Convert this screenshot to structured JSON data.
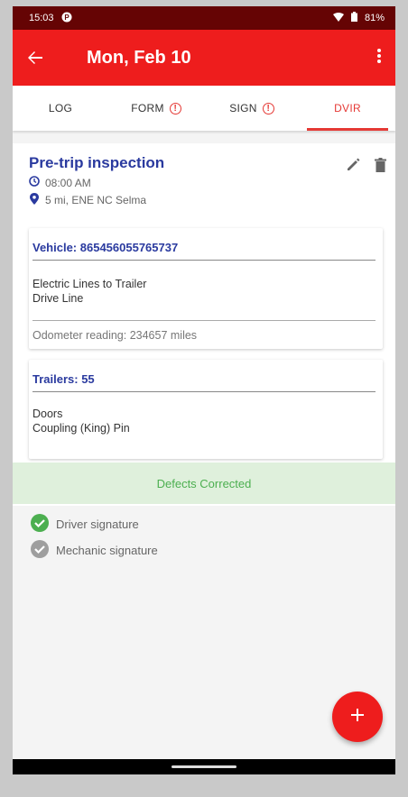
{
  "status_bar": {
    "time": "15:03",
    "battery": "81%"
  },
  "app_bar": {
    "title": "Mon, Feb 10"
  },
  "tabs": [
    {
      "label": "LOG",
      "warning": false,
      "active": false
    },
    {
      "label": "FORM",
      "warning": true,
      "active": false
    },
    {
      "label": "SIGN",
      "warning": true,
      "active": false
    },
    {
      "label": "DVIR",
      "warning": false,
      "active": true
    }
  ],
  "inspection": {
    "title": "Pre-trip inspection",
    "time": "08:00 AM",
    "location": "5 mi, ENE NC Selma"
  },
  "vehicle_card": {
    "title": "Vehicle: 865456055765737",
    "items": [
      "Electric Lines to Trailer",
      "Drive Line"
    ],
    "odometer": "Odometer reading: 234657 miles"
  },
  "trailer_card": {
    "title": "Trailers: 55",
    "items": [
      "Doors",
      "Coupling (King) Pin"
    ]
  },
  "defects_status": "Defects Corrected",
  "signatures": {
    "driver": "Driver signature",
    "mechanic": "Mechanic signature"
  },
  "colors": {
    "primary": "#ee1d1d",
    "status_bar": "#650404",
    "accent_blue": "#2a3a9f",
    "success_green": "#4caf50",
    "success_bg": "#dff0dc"
  }
}
